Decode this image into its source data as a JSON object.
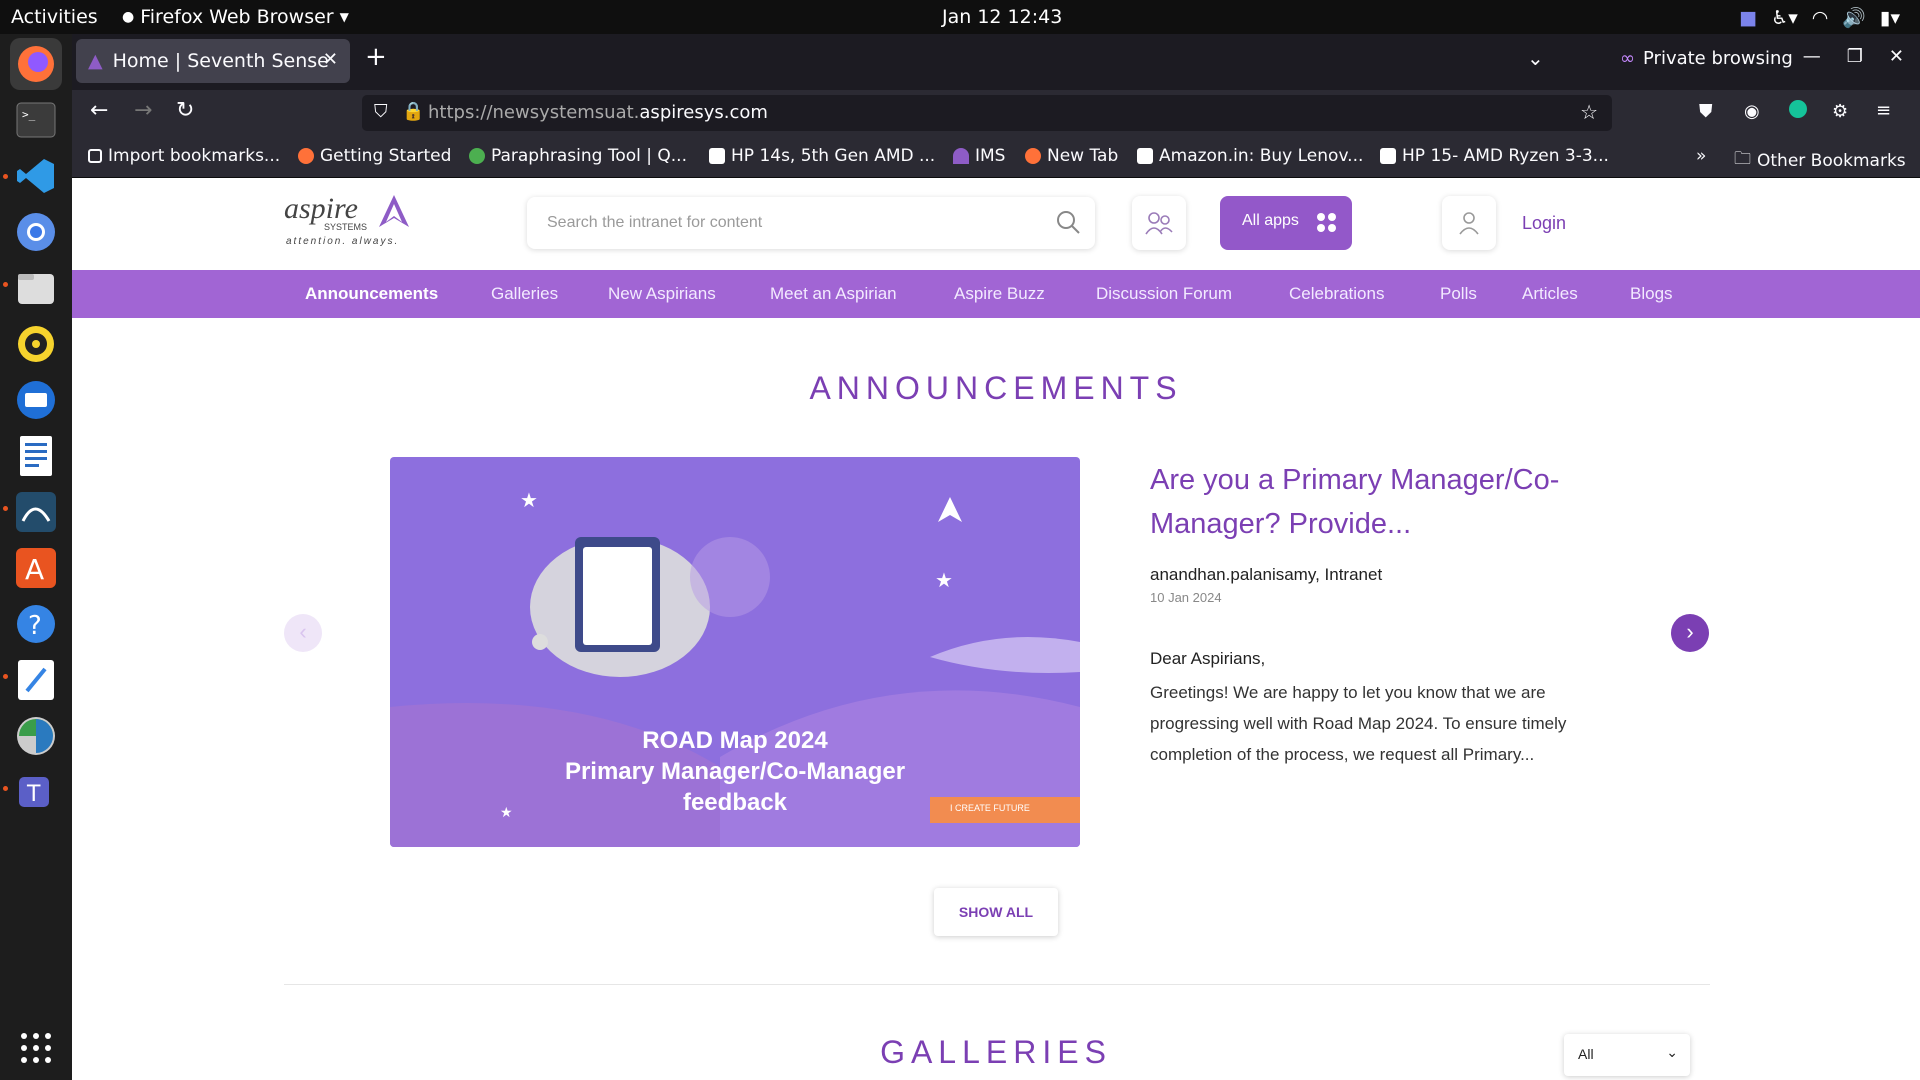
{
  "topbar": {
    "activities": "Activities",
    "app_name": "Firefox Web Browser",
    "clock": "Jan 12  12:43"
  },
  "tab": {
    "title": "Home | Seventh Sense"
  },
  "private_label": "Private browsing",
  "url": {
    "prefix": "https://newsystemsuat.",
    "domain": "aspiresys.com"
  },
  "bookmarks": [
    {
      "label": "Import bookmarks...",
      "color": "#fbfbfe"
    },
    {
      "label": "Getting Started",
      "color": "#ff7139"
    },
    {
      "label": "Paraphrasing Tool | Q...",
      "color": "#4caf50"
    },
    {
      "label": "HP 14s, 5th Gen AMD ...",
      "color": "#ffffff"
    },
    {
      "label": "IMS",
      "color": "#8e5cc6"
    },
    {
      "label": "New Tab",
      "color": "#ff7139"
    },
    {
      "label": "Amazon.in: Buy Lenov...",
      "color": "#ffffff"
    },
    {
      "label": "HP 15- AMD Ryzen 3-3...",
      "color": "#ffffff"
    }
  ],
  "other_bookmarks": "Other Bookmarks",
  "site": {
    "logo_text": "aspire",
    "logo_sub": "SYSTEMS",
    "logo_tagline": "attention. always.",
    "search_placeholder": "Search the intranet for content",
    "all_apps": "All apps",
    "login": "Login",
    "menu": [
      "Announcements",
      "Galleries",
      "New Aspirians",
      "Meet an Aspirian",
      "Aspire Buzz",
      "Discussion Forum",
      "Celebrations",
      "Polls",
      "Articles",
      "Blogs"
    ],
    "accent": "#7b3fb3"
  },
  "announcement": {
    "section_title": "ANNOUNCEMENTS",
    "banner_line1": "ROAD Map 2024",
    "banner_line2": "Primary Manager/Co-Manager",
    "banner_line3": "feedback",
    "banner_tag": "I CREATE FUTURE",
    "title": "Are you a Primary Manager/Co-Manager? Provide...",
    "meta": "anandhan.palanisamy,  Intranet",
    "date": "10 Jan 2024",
    "greeting": "Dear Aspirians,",
    "body": "Greetings! We are happy to let you know that we are progressing well with Road Map 2024. To ensure timely completion of the process, we request all Primary...",
    "show_all": "SHOW ALL"
  },
  "galleries": {
    "section_title": "GALLERIES",
    "filter_value": "All"
  }
}
